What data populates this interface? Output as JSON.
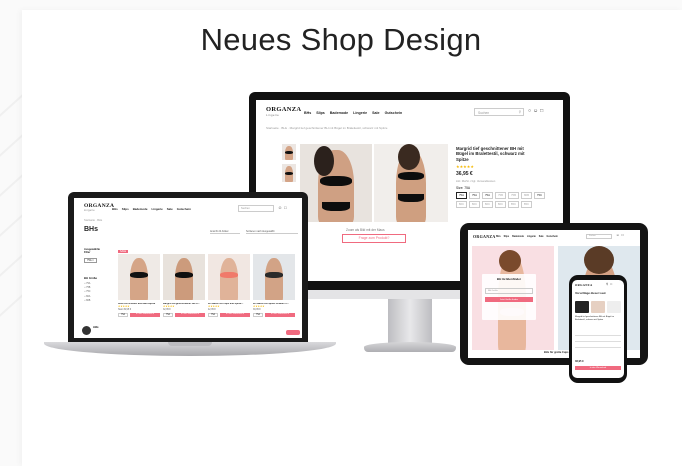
{
  "heading": "Neues Shop Design",
  "brand": {
    "name": "ORGANZA",
    "tagline": "Lingerie"
  },
  "nav": [
    "BHs",
    "Slips",
    "Bademode",
    "Lingerie",
    "Sale",
    "Gutschein"
  ],
  "search_placeholder": "Suchen",
  "monitor": {
    "breadcrumb": "Startseite  ·  BHs  ·  Margrid tief geschnittener BH mit Bügel im Bralettestil, schwarz mit Spitze",
    "product_title": "Margrid tief geschnittener BH mit Bügel im Bralettestil, schwarz mit Spitze",
    "rating_stars": "★★★★★",
    "price": "36,95 €",
    "price_note": "inkl. MwSt. zzgl. Versandkosten",
    "size_label": "Size: 75A",
    "sizes": [
      "75A",
      "75A",
      "75A",
      "75B",
      "75B",
      "80B",
      "75C",
      "80C",
      "80C",
      "80C",
      "80C",
      "85C",
      "85C"
    ],
    "caption": "Zoom als Bild mit der Maus",
    "question_button": "Frage zum Produkt?"
  },
  "laptop": {
    "breadcrumb": "Startseite  ·  BHs",
    "page_title": "BHs",
    "sort_label": "Sortieren nach Ausgewählt",
    "results_label": "Ansicht 24 Artikel",
    "filter_title": "Ausgewählte Filter",
    "filter_chip": "75A ×",
    "size_filter_title": "BH Größe",
    "size_options": [
      "75A",
      "75B",
      "75C",
      "80A",
      "80B"
    ],
    "sale_badge": "SALE",
    "products": [
      {
        "name": "Rose BH schwarz aus Mikrospitze",
        "price": "Statt 49,95 €",
        "size": "75A",
        "button": "In den Warenkorb"
      },
      {
        "name": "Margrid BH geschnittener BH m...",
        "price": "32,95 €",
        "size": "75A",
        "button": "In den Warenkorb"
      },
      {
        "name": "Mi Valerie mit Cups und Spitze...",
        "price": "42,95 €",
        "size": "75A",
        "button": "In den Warenkorb"
      },
      {
        "name": "Mi Valerie BH Spitze schwarz U...",
        "price": "39,95 €",
        "size": "75A",
        "button": "In den Warenkorb"
      }
    ],
    "chat_label": "Hilfe"
  },
  "tablet": {
    "finder_title": "BH Größenfinder",
    "finder_input": "BH Größe",
    "finder_button": "Jetzt Größe finden",
    "banner_caption": "BHs für große Cups"
  },
  "phone": {
    "headline": "Vorschläge dieser Laut",
    "product": "Margrid tief geschnittener BH mit Bügel im Bralettestil, schwarz mit Spitze",
    "price": "36,95 €",
    "cart_button": "In den Warenkorb"
  },
  "colors": {
    "accent": "#f06a7f",
    "stars": "#f5b800",
    "device_frame": "#111111",
    "banner_pink": "#f9dfe3"
  }
}
